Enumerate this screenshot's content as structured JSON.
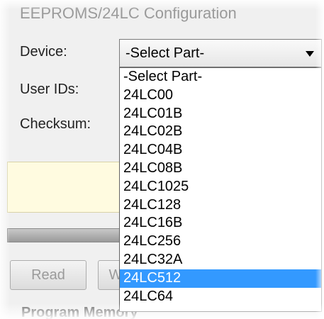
{
  "group": {
    "title": "EEPROMS/24LC Configuration"
  },
  "fields": {
    "device_label": "Device:",
    "user_ids_label": "User IDs:",
    "checksum_label": "Checksum:"
  },
  "device_select": {
    "value": "-Select Part-",
    "options": [
      "-Select Part-",
      "24LC00",
      "24LC01B",
      "24LC02B",
      "24LC04B",
      "24LC08B",
      "24LC1025",
      "24LC128",
      "24LC16B",
      "24LC256",
      "24LC32A",
      "24LC512",
      "24LC64"
    ],
    "highlighted": "24LC512"
  },
  "buttons": {
    "read_label": "Read",
    "write_partial": "W"
  },
  "section": {
    "title": "Program Memory"
  },
  "colors": {
    "highlight": "#3399ff",
    "info_box": "#fffbe0"
  }
}
